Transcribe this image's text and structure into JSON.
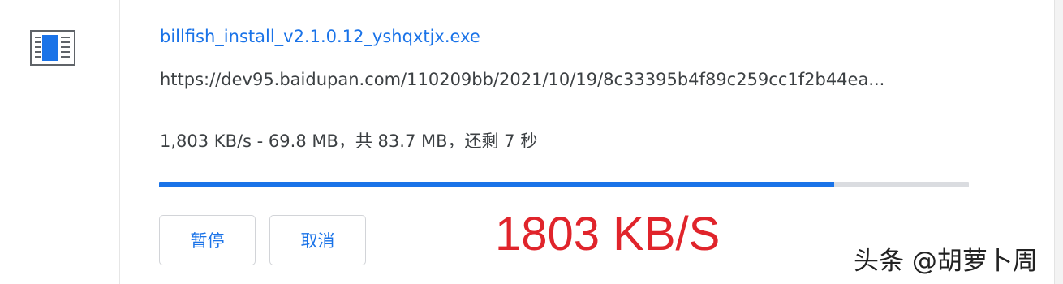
{
  "download": {
    "file_name": "billfish_install_v2.1.0.12_yshqxtjx.exe",
    "url": "https://dev95.baidupan.com/110209bb/2021/10/19/8c33395b4f89c259cc1f2b44ea...",
    "status": "1,803 KB/s - 69.8 MB，共 83.7 MB，还剩 7 秒",
    "progress_fraction": 0.834,
    "pause_label": "暂停",
    "cancel_label": "取消",
    "icon": "file-window-icon"
  },
  "overlay": {
    "speed_text": "1803 KB/S",
    "watermark": "头条 @胡萝卜周"
  },
  "colors": {
    "accent": "#1a73e8",
    "track": "#dadce0",
    "speed_red": "#e0242b"
  }
}
